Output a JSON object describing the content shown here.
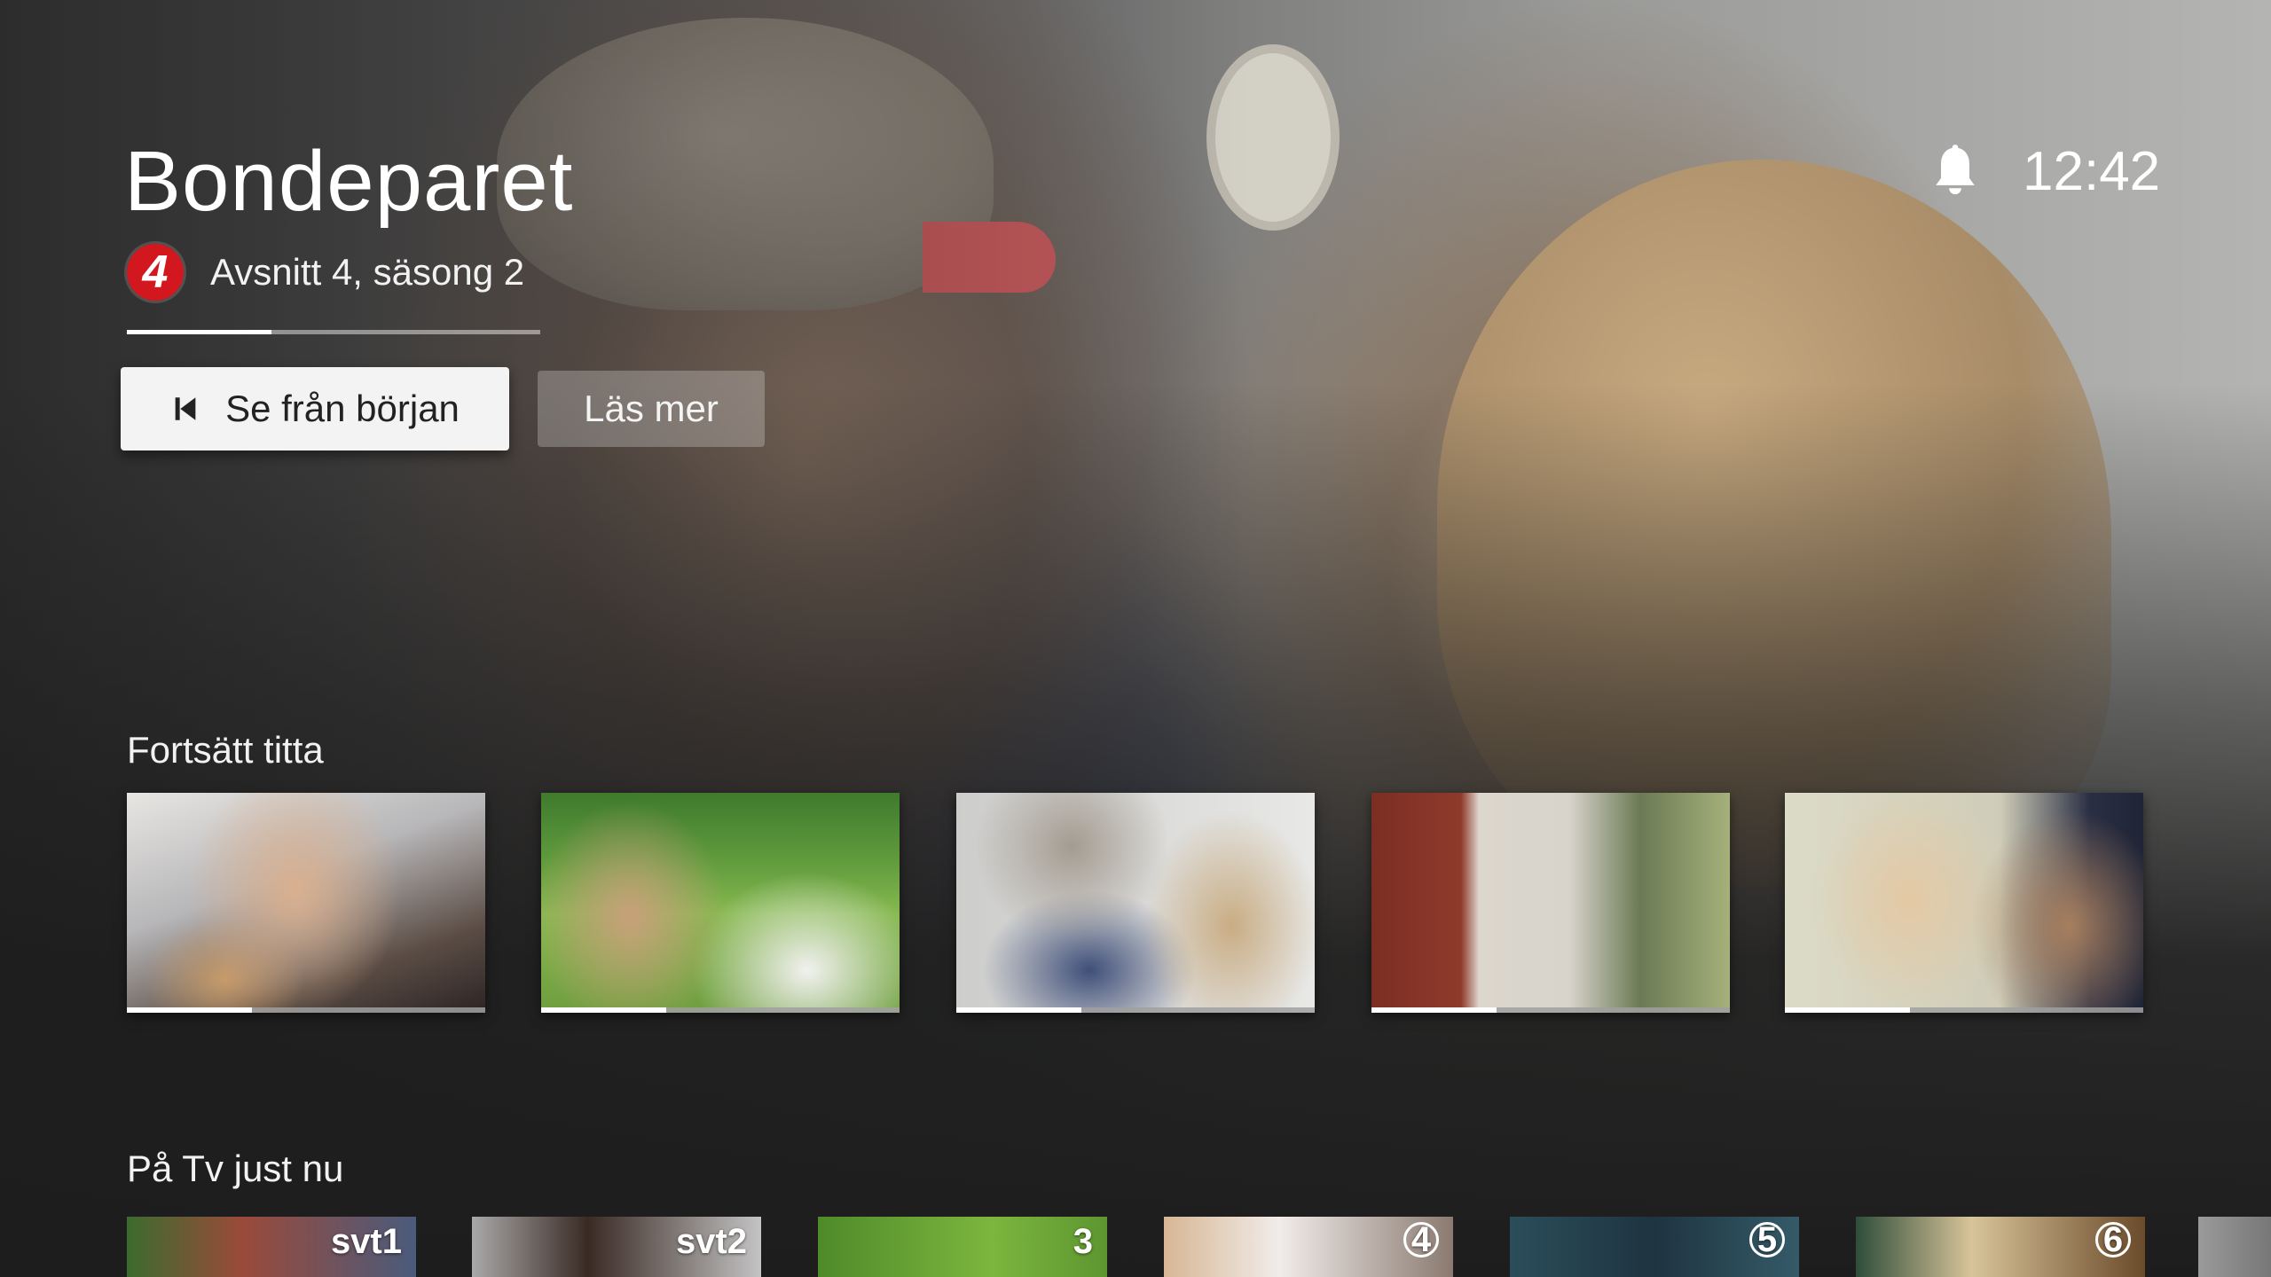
{
  "hero": {
    "title": "Bondeparet",
    "channel_logo": "4",
    "episode": "Avsnitt 4, säsong 2",
    "progress": 0.35,
    "buttons": {
      "start_label": "Se från början",
      "start_icon": "skip-previous-icon",
      "more_label": "Läs mer"
    }
  },
  "status": {
    "bell_icon": "notification-bell-icon",
    "time": "12:42"
  },
  "rows": {
    "continue": {
      "title": "Fortsätt titta",
      "items": [
        {
          "progress": 0.35
        },
        {
          "progress": 0.35
        },
        {
          "progress": 0.35
        },
        {
          "progress": 0.35
        },
        {
          "progress": 0.35
        }
      ]
    },
    "live": {
      "title": "På Tv just nu",
      "items": [
        {
          "badge": "svt1"
        },
        {
          "badge": "svt2"
        },
        {
          "badge": "3"
        },
        {
          "badge": "4"
        },
        {
          "badge": "5"
        },
        {
          "badge": "6"
        },
        {
          "badge": ""
        }
      ]
    }
  },
  "colors": {
    "background": "#1d1d1d",
    "tv4_red": "#d3171f",
    "button_bg": "#f3f3f3"
  }
}
